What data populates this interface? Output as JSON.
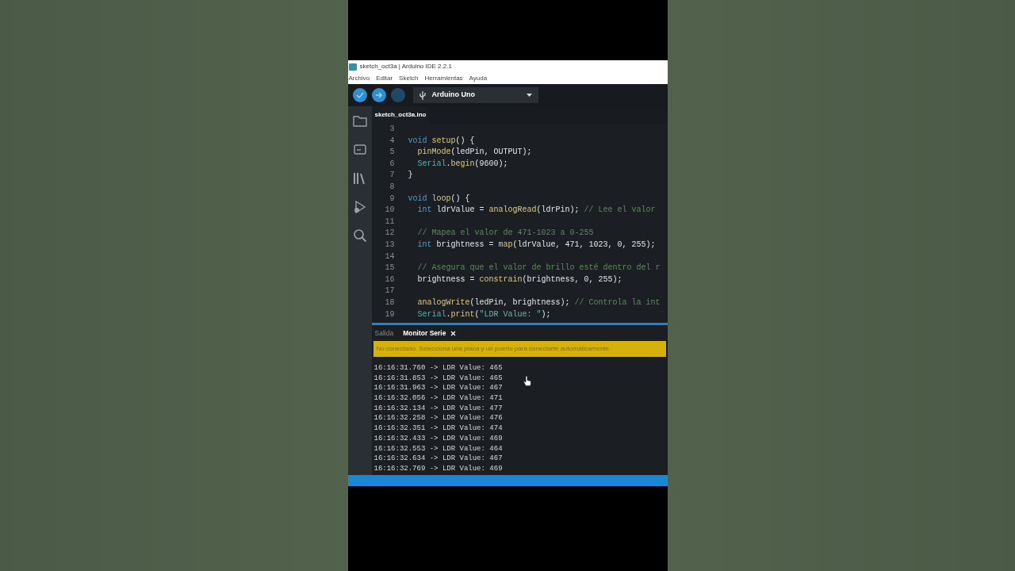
{
  "window": {
    "title": "sketch_oct3a | Arduino IDE 2.2.1"
  },
  "menu": [
    "Archivo",
    "Editar",
    "Sketch",
    "Herramientas",
    "Ayuda"
  ],
  "toolbar": {
    "board": "Arduino Uno"
  },
  "sidebar": {
    "items": [
      {
        "kind": "folder",
        "selected": false
      },
      {
        "kind": "board",
        "selected": false
      },
      {
        "kind": "library",
        "selected": false
      },
      {
        "kind": "debug",
        "selected": false
      },
      {
        "kind": "search",
        "selected": false
      }
    ]
  },
  "editor_tabs": [
    {
      "label": "sketch_oct3a.ino",
      "selected": true
    }
  ],
  "code_lines": [
    {
      "number": "3"
    },
    {
      "number": "4",
      "indented": false,
      "tokens": [
        {
          "kind": "keyword",
          "text": "void "
        },
        {
          "kind": "function",
          "text": "setup"
        },
        {
          "kind": "plain",
          "text": "() {"
        }
      ]
    },
    {
      "number": "5",
      "indented": true,
      "tokens": [
        {
          "kind": "function",
          "text": "pinMode"
        },
        {
          "kind": "plain",
          "text": "(ledPin, OUTPUT);"
        }
      ]
    },
    {
      "number": "6",
      "indented": true,
      "tokens": [
        {
          "kind": "type",
          "text": "Serial"
        },
        {
          "kind": "plain",
          "text": "."
        },
        {
          "kind": "function",
          "text": "begin"
        },
        {
          "kind": "plain",
          "text": "(9600);"
        }
      ]
    },
    {
      "number": "7",
      "indented": false,
      "tokens": [
        {
          "kind": "plain",
          "text": "}"
        }
      ]
    },
    {
      "number": "8"
    },
    {
      "number": "9",
      "indented": false,
      "tokens": [
        {
          "kind": "keyword",
          "text": "void "
        },
        {
          "kind": "function",
          "text": "loop"
        },
        {
          "kind": "plain",
          "text": "() {"
        }
      ]
    },
    {
      "number": "10",
      "indented": true,
      "tokens": [
        {
          "kind": "keyword",
          "text": "int"
        },
        {
          "kind": "plain",
          "text": " ldrValue = "
        },
        {
          "kind": "function",
          "text": "analogRead"
        },
        {
          "kind": "plain",
          "text": "(ldrPin); "
        },
        {
          "kind": "comment",
          "text": "// Lee el valor"
        }
      ]
    },
    {
      "number": "11"
    },
    {
      "number": "12",
      "indented": true,
      "tokens": [
        {
          "kind": "comment",
          "text": "// Mapea el valor de 471-1023 a 0-255"
        }
      ]
    },
    {
      "number": "13",
      "indented": true,
      "tokens": [
        {
          "kind": "keyword",
          "text": "int"
        },
        {
          "kind": "plain",
          "text": " brightness = "
        },
        {
          "kind": "function",
          "text": "map"
        },
        {
          "kind": "plain",
          "text": "(ldrValue, 471, 1023, 0, 255);"
        }
      ]
    },
    {
      "number": "14"
    },
    {
      "number": "15",
      "indented": true,
      "tokens": [
        {
          "kind": "comment",
          "text": "// Asegura que el valor de brillo esté dentro del r"
        }
      ]
    },
    {
      "number": "16",
      "indented": true,
      "tokens": [
        {
          "kind": "plain",
          "text": "brightness = "
        },
        {
          "kind": "function",
          "text": "constrain"
        },
        {
          "kind": "plain",
          "text": "(brightness, 0, 255);"
        }
      ]
    },
    {
      "number": "17"
    },
    {
      "number": "18",
      "indented": true,
      "tokens": [
        {
          "kind": "function",
          "text": "analogWrite"
        },
        {
          "kind": "plain",
          "text": "(ledPin, brightness); "
        },
        {
          "kind": "comment",
          "text": "// Controla la int"
        }
      ]
    },
    {
      "number": "19",
      "indented": true,
      "tokens": [
        {
          "kind": "type",
          "text": "Serial"
        },
        {
          "kind": "plain",
          "text": "."
        },
        {
          "kind": "function",
          "text": "print"
        },
        {
          "kind": "plain",
          "text": "("
        },
        {
          "kind": "string",
          "text": "\"LDR Value: \""
        },
        {
          "kind": "plain",
          "text": ");"
        }
      ]
    }
  ],
  "panel_tabs": [
    {
      "label": "Salida",
      "selected": false
    },
    {
      "label": "Monitor Serie",
      "selected": true
    }
  ],
  "notice": "No conectado. Selecciona una placa y un puerto para conectarte automáticamente",
  "serial_output": [
    "16:16:31.760 -> LDR Value: 465",
    "16:16:31.853 -> LDR Value: 465",
    "16:16:31.963 -> LDR Value: 467",
    "16:16:32.056 -> LDR Value: 471",
    "16:16:32.134 -> LDR Value: 477",
    "16:16:32.258 -> LDR Value: 476",
    "16:16:32.351 -> LDR Value: 474",
    "16:16:32.433 -> LDR Value: 469",
    "16:16:32.553 -> LDR Value: 464",
    "16:16:32.634 -> LDR Value: 467",
    "16:16:32.769 -> LDR Value: 469"
  ]
}
